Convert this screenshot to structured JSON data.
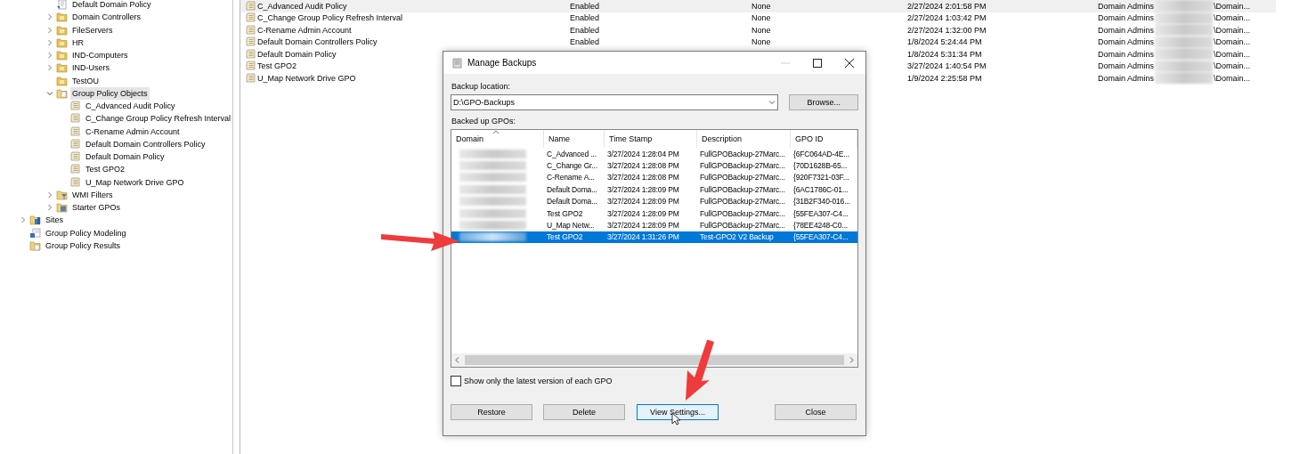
{
  "tree": {
    "domain_items": [
      {
        "label": "Default Domain Policy",
        "kind": "gpo-link",
        "expandable": false,
        "selected": false
      },
      {
        "label": "Domain Controllers",
        "kind": "ou",
        "expandable": true,
        "expanded": false,
        "selected": false
      },
      {
        "label": "FileServers",
        "kind": "ou",
        "expandable": true,
        "expanded": false,
        "selected": false
      },
      {
        "label": "HR",
        "kind": "ou",
        "expandable": true,
        "expanded": false,
        "selected": false
      },
      {
        "label": "IND-Computers",
        "kind": "ou",
        "expandable": true,
        "expanded": false,
        "selected": false
      },
      {
        "label": "IND-Users",
        "kind": "ou",
        "expandable": true,
        "expanded": false,
        "selected": false
      },
      {
        "label": "TestOU",
        "kind": "ou",
        "expandable": false,
        "selected": false
      },
      {
        "label": "Group Policy Objects",
        "kind": "gpo-folder",
        "expandable": true,
        "expanded": true,
        "selected": true,
        "children": [
          {
            "label": "C_Advanced Audit Policy",
            "kind": "gpo",
            "expandable": false,
            "selected": false
          },
          {
            "label": "C_Change Group Policy Refresh Interval",
            "kind": "gpo",
            "expandable": false,
            "selected": false
          },
          {
            "label": "C-Rename Admin Account",
            "kind": "gpo",
            "expandable": false,
            "selected": false
          },
          {
            "label": "Default Domain Controllers Policy",
            "kind": "gpo",
            "expandable": false,
            "selected": false
          },
          {
            "label": "Default Domain Policy",
            "kind": "gpo",
            "expandable": false,
            "selected": false
          },
          {
            "label": "Test GPO2",
            "kind": "gpo",
            "expandable": false,
            "selected": false
          },
          {
            "label": "U_Map Network Drive GPO",
            "kind": "gpo",
            "expandable": false,
            "selected": false
          }
        ]
      },
      {
        "label": "WMI Filters",
        "kind": "filter-folder",
        "expandable": true,
        "expanded": false,
        "selected": false
      },
      {
        "label": "Starter GPOs",
        "kind": "starter-folder",
        "expandable": true,
        "expanded": false,
        "selected": false
      }
    ],
    "root_items": [
      {
        "label": "Sites",
        "kind": "sites",
        "expandable": true,
        "expanded": false,
        "selected": false
      },
      {
        "label": "Group Policy Modeling",
        "kind": "modeling",
        "expandable": false,
        "selected": false
      },
      {
        "label": "Group Policy Results",
        "kind": "results",
        "expandable": false,
        "selected": false
      }
    ]
  },
  "gpo_table": {
    "rows": [
      {
        "name": "C_Advanced Audit Policy",
        "status": "Enabled",
        "wmi": "None",
        "modified": "2/27/2024 2:01:58 PM",
        "owner_start": "Domain Admins",
        "owner_end": "\\Domain...",
        "hovered": true
      },
      {
        "name": "C_Change Group Policy Refresh Interval",
        "status": "Enabled",
        "wmi": "None",
        "modified": "2/27/2024 1:03:42 PM",
        "owner_start": "Domain Admins",
        "owner_end": "\\Domain...",
        "hovered": false
      },
      {
        "name": "C-Rename Admin Account",
        "status": "Enabled",
        "wmi": "None",
        "modified": "2/27/2024 1:32:00 PM",
        "owner_start": "Domain Admins",
        "owner_end": "\\Domain...",
        "hovered": false
      },
      {
        "name": "Default Domain Controllers Policy",
        "status": "Enabled",
        "wmi": "None",
        "modified": "1/8/2024 5:24:44 PM",
        "owner_start": "Domain Admins",
        "owner_end": "\\Domain...",
        "hovered": false
      },
      {
        "name": "Default Domain Policy",
        "modified": "1/8/2024 5:31:34 PM",
        "owner_start": "Domain Admins",
        "owner_end": "\\Domain...",
        "hovered": false
      },
      {
        "name": "Test GPO2",
        "modified": "3/27/2024 1:40:54 PM",
        "owner_start": "Domain Admins",
        "owner_end": "\\Domain...",
        "hovered": false
      },
      {
        "name": "U_Map Network Drive GPO",
        "modified": "1/9/2024 2:25:58 PM",
        "owner_start": "Domain Admins",
        "owner_end": "\\Domain...",
        "hovered": false
      }
    ]
  },
  "dialog": {
    "title": "Manage Backups",
    "location_label": "Backup location:",
    "location_value": "D:\\GPO-Backups",
    "browse": "Browse...",
    "list_label": "Backed up GPOs:",
    "columns": [
      {
        "label": "Domain",
        "sorted": true
      },
      {
        "label": "Name",
        "sorted": false
      },
      {
        "label": "Time Stamp",
        "sorted": false
      },
      {
        "label": "Description",
        "sorted": false
      },
      {
        "label": "GPO ID",
        "sorted": false
      }
    ],
    "rows": [
      {
        "name": "C_Advanced ...",
        "timestamp": "3/27/2024 1:28:04 PM",
        "description": "FullGPOBackup-27Marc...",
        "gpo_id": "{6FC064AD-4E...",
        "selected": false
      },
      {
        "name": "C_Change Gr...",
        "timestamp": "3/27/2024 1:28:08 PM",
        "description": "FullGPOBackup-27Marc...",
        "gpo_id": "{70D1628B-65...",
        "selected": false
      },
      {
        "name": "C-Rename A...",
        "timestamp": "3/27/2024 1:28:08 PM",
        "description": "FullGPOBackup-27Marc...",
        "gpo_id": "{920F7321-03F...",
        "selected": false
      },
      {
        "name": "Default Doma...",
        "timestamp": "3/27/2024 1:28:09 PM",
        "description": "FullGPOBackup-27Marc...",
        "gpo_id": "{6AC1786C-01...",
        "selected": false
      },
      {
        "name": "Default Doma...",
        "timestamp": "3/27/2024 1:28:09 PM",
        "description": "FullGPOBackup-27Marc...",
        "gpo_id": "{31B2F340-016...",
        "selected": false
      },
      {
        "name": "Test GPO2",
        "timestamp": "3/27/2024 1:28:09 PM",
        "description": "FullGPOBackup-27Marc...",
        "gpo_id": "{55FEA307-C4...",
        "selected": false
      },
      {
        "name": "U_Map Netw...",
        "timestamp": "3/27/2024 1:28:09 PM",
        "description": "FullGPOBackup-27Marc...",
        "gpo_id": "{78EE4248-C0...",
        "selected": false
      },
      {
        "name": "Test GPO2",
        "timestamp": "3/27/2024 1:31:26 PM",
        "description": "Test-GPO2 V2 Backup",
        "gpo_id": "{55FEA307-C4...",
        "selected": true
      }
    ],
    "latest_only": {
      "label": "Show only the latest version of each GPO",
      "checked": false
    },
    "buttons": [
      {
        "label": "Restore",
        "hovered": false
      },
      {
        "label": "Delete",
        "hovered": false
      },
      {
        "label": "View Settings...",
        "hovered": true
      },
      {
        "label": "Close",
        "hovered": false
      }
    ]
  }
}
